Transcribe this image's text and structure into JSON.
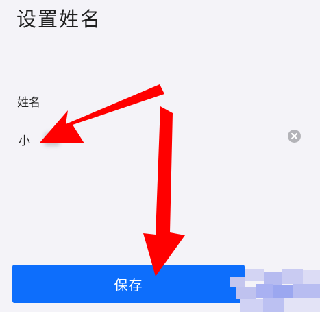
{
  "page": {
    "title": "设置姓名"
  },
  "form": {
    "name_label": "姓名",
    "name_value": "小",
    "name_value_obscured": true
  },
  "actions": {
    "save_label": "保存"
  },
  "icons": {
    "clear": "clear-circle-icon"
  },
  "colors": {
    "primary": "#0d6efc",
    "underline": "#2f6fbf",
    "background": "#f4f3f8",
    "annotation": "#ff0000"
  }
}
